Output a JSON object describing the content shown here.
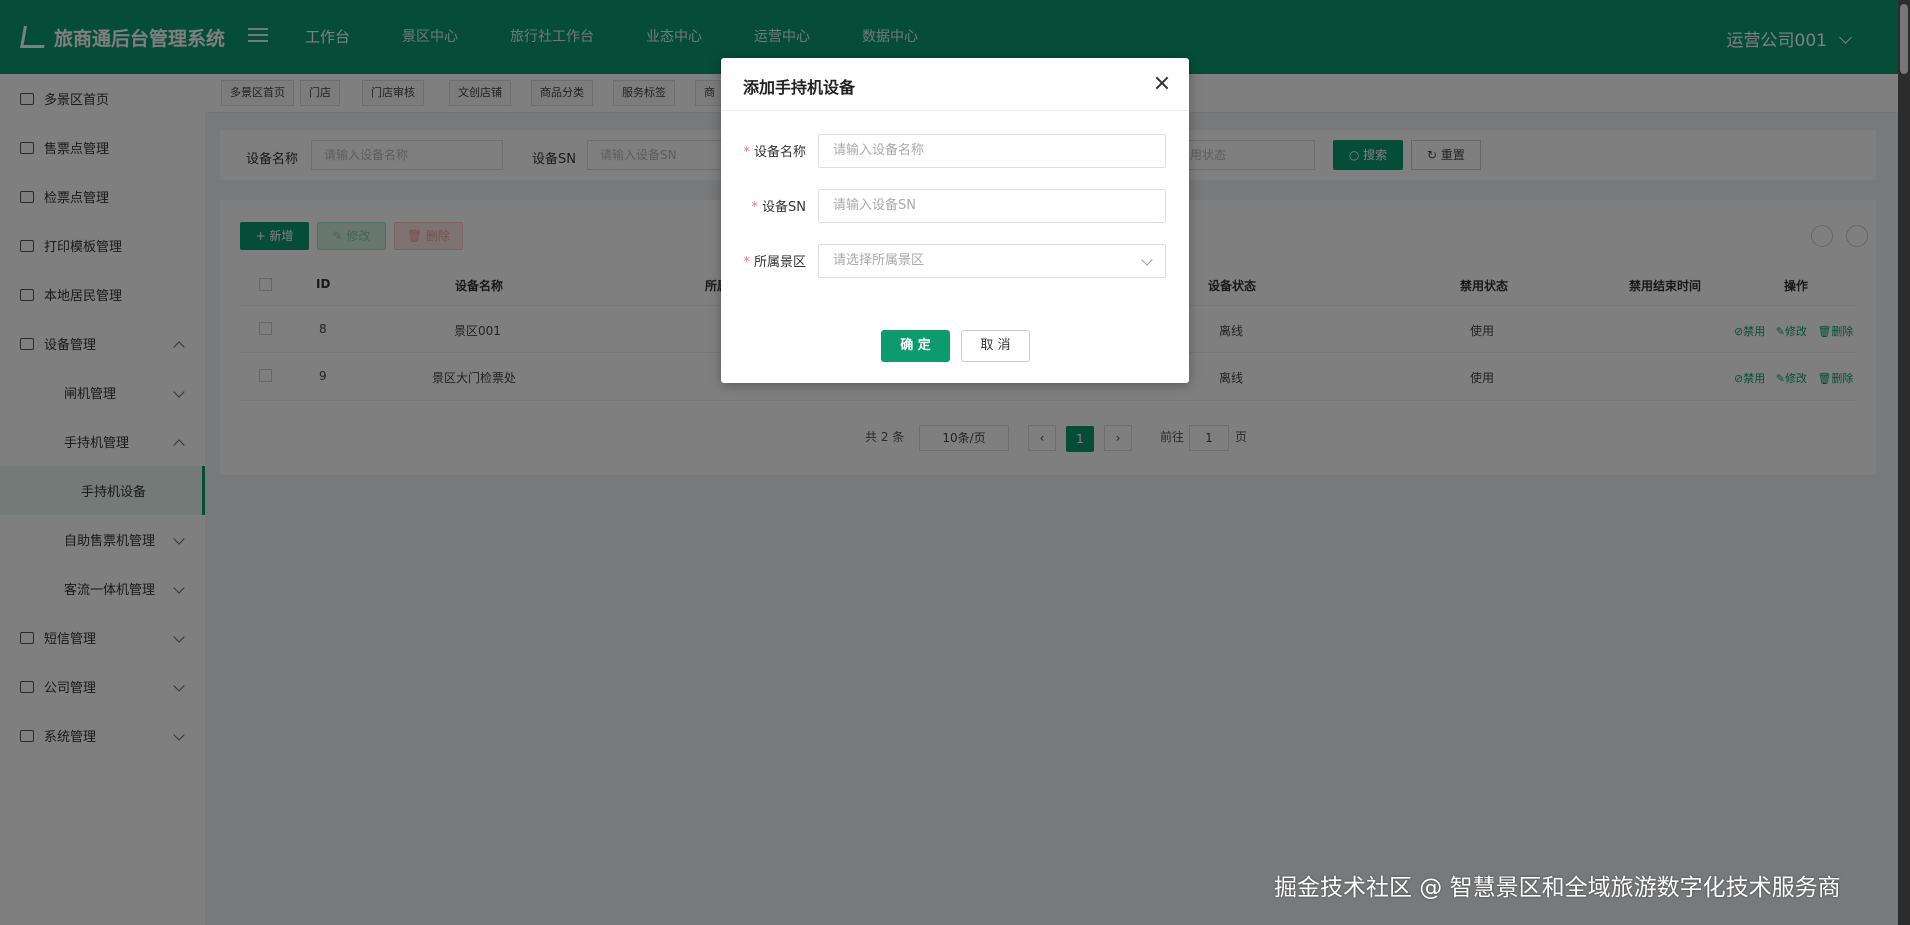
{
  "header": {
    "logo_text": "旅商通后台管理系统",
    "nav": [
      "工作台",
      "景区中心",
      "旅行社工作台",
      "业态中心",
      "运营中心",
      "数据中心"
    ],
    "company": "运营公司001"
  },
  "sidebar": {
    "items": [
      {
        "label": "多景区首页"
      },
      {
        "label": "售票点管理"
      },
      {
        "label": "检票点管理"
      },
      {
        "label": "打印模板管理"
      },
      {
        "label": "本地居民管理"
      },
      {
        "label": "设备管理"
      },
      {
        "label": "闸机管理"
      },
      {
        "label": "手持机管理"
      },
      {
        "label": "手持机设备"
      },
      {
        "label": "自助售票机管理"
      },
      {
        "label": "客流一体机管理"
      },
      {
        "label": "短信管理"
      },
      {
        "label": "公司管理"
      },
      {
        "label": "系统管理"
      }
    ]
  },
  "tags": [
    "多景区首页",
    "门店",
    "门店审核",
    "文创店铺",
    "商品分类",
    "服务标签",
    "商"
  ],
  "filter": {
    "device_name_label": "设备名称",
    "device_name_placeholder": "请输入设备名称",
    "sn_label": "设备SN",
    "sn_placeholder": "请输入设备SN",
    "status_placeholder": "禁用状态",
    "search": "搜索",
    "reset": "重置"
  },
  "toolbar": {
    "add": "+ 新增",
    "edit": "修改",
    "delete": "删除"
  },
  "table": {
    "headers": [
      "ID",
      "设备名称",
      "所属",
      "设备状态",
      "禁用状态",
      "禁用结束时间",
      "操作"
    ],
    "rows": [
      {
        "id": "8",
        "name": "景区001",
        "status": "离线",
        "disable": "使用"
      },
      {
        "id": "9",
        "name": "景区大门检票处",
        "status": "离线",
        "disable": "使用"
      }
    ],
    "ops": {
      "disable": "禁用",
      "edit": "修改",
      "delete": "删除"
    }
  },
  "pagination": {
    "total": "共 2 条",
    "page_size": "10条/页",
    "current": "1",
    "goto_label": "前往",
    "goto_value": "1",
    "page_unit": "页"
  },
  "modal": {
    "title": "添加手持机设备",
    "fields": [
      {
        "label": "设备名称",
        "placeholder": "请输入设备名称"
      },
      {
        "label": "设备SN",
        "placeholder": "请输入设备SN"
      },
      {
        "label": "所属景区",
        "placeholder": "请选择所属景区"
      }
    ],
    "required_mark": "*",
    "ok": "确 定",
    "cancel": "取 消"
  },
  "watermark": "掘金技术社区 @ 智慧景区和全域旅游数字化技术服务商",
  "colors": {
    "primary": "#0d9b6e",
    "danger": "#f56c6c"
  }
}
